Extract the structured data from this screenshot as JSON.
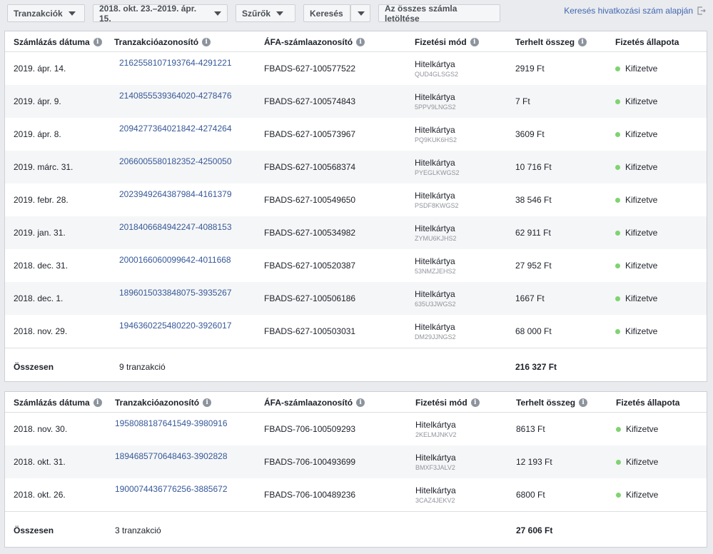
{
  "toolbar": {
    "transactions": "Tranzakciók",
    "date_range": "2018. okt. 23.–2019. ápr. 15.",
    "filters": "Szűrők",
    "search": "Keresés",
    "download_all": "Az összes számla letöltése",
    "search_by_reference": "Keresés hivatkozási szám alapján"
  },
  "headers": {
    "date": "Számlázás dátuma",
    "transaction_id": "Tranzakcióazonosító",
    "vat_id": "ÁFA-számlaazonosító",
    "payment_method": "Fizetési mód",
    "amount": "Terhelt összeg",
    "status": "Fizetés állapota"
  },
  "panels": [
    {
      "rows": [
        {
          "date": "2019. ápr. 14.",
          "tx": "2162558107193764-4291221",
          "vat": "FBADS-627-100577522",
          "pay": "Hitelkártya",
          "pay_sub": "QUD4GLSGS2",
          "amount": "2919 Ft",
          "status": "Kifizetve"
        },
        {
          "date": "2019. ápr. 9.",
          "tx": "2140855539364020-4278476",
          "vat": "FBADS-627-100574843",
          "pay": "Hitelkártya",
          "pay_sub": "5PPV9LNGS2",
          "amount": "7 Ft",
          "status": "Kifizetve"
        },
        {
          "date": "2019. ápr. 8.",
          "tx": "2094277364021842-4274264",
          "vat": "FBADS-627-100573967",
          "pay": "Hitelkártya",
          "pay_sub": "PQ9KUK6HS2",
          "amount": "3609 Ft",
          "status": "Kifizetve"
        },
        {
          "date": "2019. márc. 31.",
          "tx": "2066005580182352-4250050",
          "vat": "FBADS-627-100568374",
          "pay": "Hitelkártya",
          "pay_sub": "PYEGLKWGS2",
          "amount": "10 716 Ft",
          "status": "Kifizetve"
        },
        {
          "date": "2019. febr. 28.",
          "tx": "2023949264387984-4161379",
          "vat": "FBADS-627-100549650",
          "pay": "Hitelkártya",
          "pay_sub": "PSDF8KWGS2",
          "amount": "38 546 Ft",
          "status": "Kifizetve"
        },
        {
          "date": "2019. jan. 31.",
          "tx": "2018406684942247-4088153",
          "vat": "FBADS-627-100534982",
          "pay": "Hitelkártya",
          "pay_sub": "ZYMU6KJHS2",
          "amount": "62 911 Ft",
          "status": "Kifizetve"
        },
        {
          "date": "2018. dec. 31.",
          "tx": "2000166060099642-4011668",
          "vat": "FBADS-627-100520387",
          "pay": "Hitelkártya",
          "pay_sub": "53NMZJEHS2",
          "amount": "27 952 Ft",
          "status": "Kifizetve"
        },
        {
          "date": "2018. dec. 1.",
          "tx": "1896015033848075-3935267",
          "vat": "FBADS-627-100506186",
          "pay": "Hitelkártya",
          "pay_sub": "635U3JWGS2",
          "amount": "1667 Ft",
          "status": "Kifizetve"
        },
        {
          "date": "2018. nov. 29.",
          "tx": "1946360225480220-3926017",
          "vat": "FBADS-627-100503031",
          "pay": "Hitelkártya",
          "pay_sub": "DM29JJNGS2",
          "amount": "68 000 Ft",
          "status": "Kifizetve"
        }
      ],
      "total_label": "Összesen",
      "total_count": "9 tranzakció",
      "total_amount": "216 327 Ft"
    },
    {
      "rows": [
        {
          "date": "2018. nov. 30.",
          "tx": "1958088187641549-3980916",
          "vat": "FBADS-706-100509293",
          "pay": "Hitelkártya",
          "pay_sub": "2KELMJNKV2",
          "amount": "8613 Ft",
          "status": "Kifizetve"
        },
        {
          "date": "2018. okt. 31.",
          "tx": "1894685770648463-3902828",
          "vat": "FBADS-706-100493699",
          "pay": "Hitelkártya",
          "pay_sub": "BMXF3JALV2",
          "amount": "12 193 Ft",
          "status": "Kifizetve"
        },
        {
          "date": "2018. okt. 26.",
          "tx": "1900074436776256-3885672",
          "vat": "FBADS-706-100489236",
          "pay": "Hitelkártya",
          "pay_sub": "3CAZ4JEKV2",
          "amount": "6800 Ft",
          "status": "Kifizetve"
        }
      ],
      "total_label": "Összesen",
      "total_count": "3 tranzakció",
      "total_amount": "27 606 Ft"
    }
  ],
  "colors": {
    "link": "#365899",
    "paid_dot": "#7fd371",
    "header_link": "#4267b2"
  }
}
